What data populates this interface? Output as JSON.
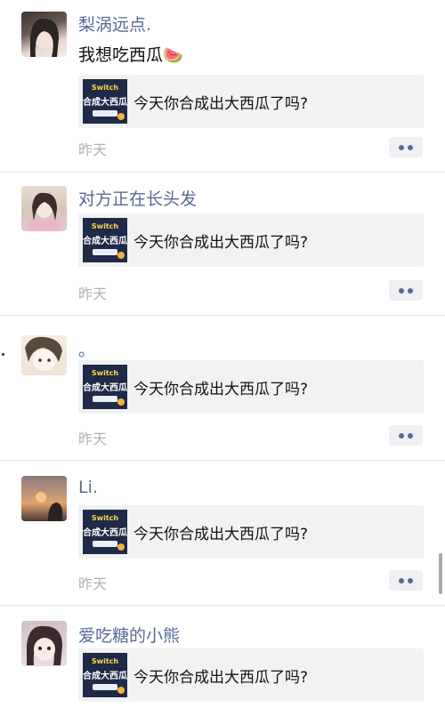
{
  "posts": [
    {
      "name": "梨涡远点.",
      "text": "我想吃西瓜",
      "emoji": "🍉",
      "card_title": "今天你合成出大西瓜了吗?",
      "card_thumb_line1": "Switch",
      "card_thumb_line2": "合成大西瓜",
      "time": "昨天"
    },
    {
      "name": "对方正在长头发",
      "text": "",
      "card_title": "今天你合成出大西瓜了吗?",
      "card_thumb_line1": "Switch",
      "card_thumb_line2": "合成大西瓜",
      "time": "昨天"
    },
    {
      "name": "。",
      "text": "",
      "card_title": "今天你合成出大西瓜了吗?",
      "card_thumb_line1": "Switch",
      "card_thumb_line2": "合成大西瓜",
      "time": "昨天"
    },
    {
      "name": "Li.",
      "text": "",
      "card_title": "今天你合成出大西瓜了吗?",
      "card_thumb_line1": "Switch",
      "card_thumb_line2": "合成大西瓜",
      "time": "昨天"
    },
    {
      "name": "爱吃糖的小熊",
      "text": "",
      "card_title": "今天你合成出大西瓜了吗?",
      "card_thumb_line1": "Switch",
      "card_thumb_line2": "合成大西瓜",
      "time": ""
    }
  ],
  "colors": {
    "name": "#576b95",
    "time": "#b2b2b2",
    "card_bg": "#f2f2f2",
    "thumb_bg": "#1f2a49",
    "divider": "#e6e6e6"
  },
  "icons": {
    "more": "two-dots-icon",
    "card_thumb": "game-thumbnail-icon"
  }
}
